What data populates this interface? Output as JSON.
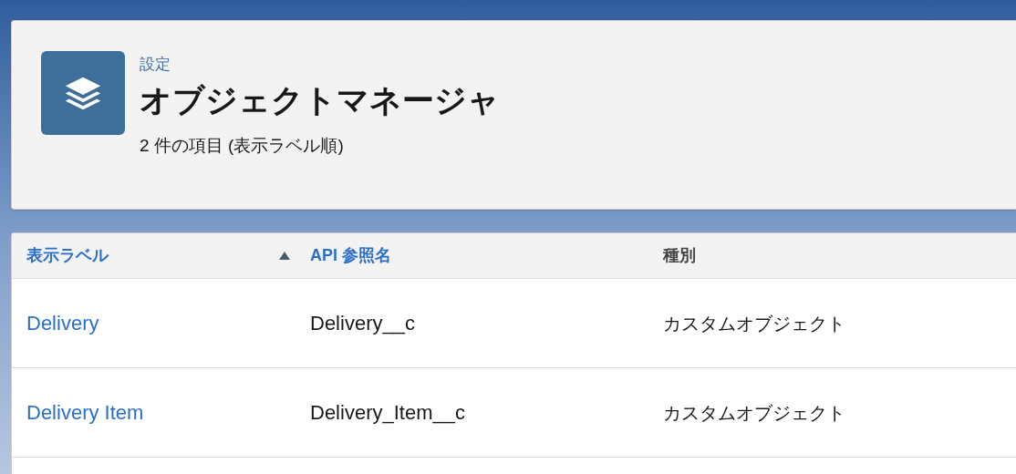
{
  "header": {
    "breadcrumb": "設定",
    "title": "オブジェクトマネージャ",
    "summary": "2 件の項目 (表示ラベル順)"
  },
  "table": {
    "columns": [
      {
        "label": "表示ラベル",
        "sortable": true,
        "sorted": true
      },
      {
        "label": "API 参照名",
        "sortable": true,
        "sorted": false
      },
      {
        "label": "種別",
        "sortable": false,
        "sorted": false
      }
    ],
    "rows": [
      {
        "label": "Delivery",
        "api_name": "Delivery__c",
        "type": "カスタムオブジェクト"
      },
      {
        "label": "Delivery Item",
        "api_name": "Delivery_Item__c",
        "type": "カスタムオブジェクト"
      }
    ]
  }
}
